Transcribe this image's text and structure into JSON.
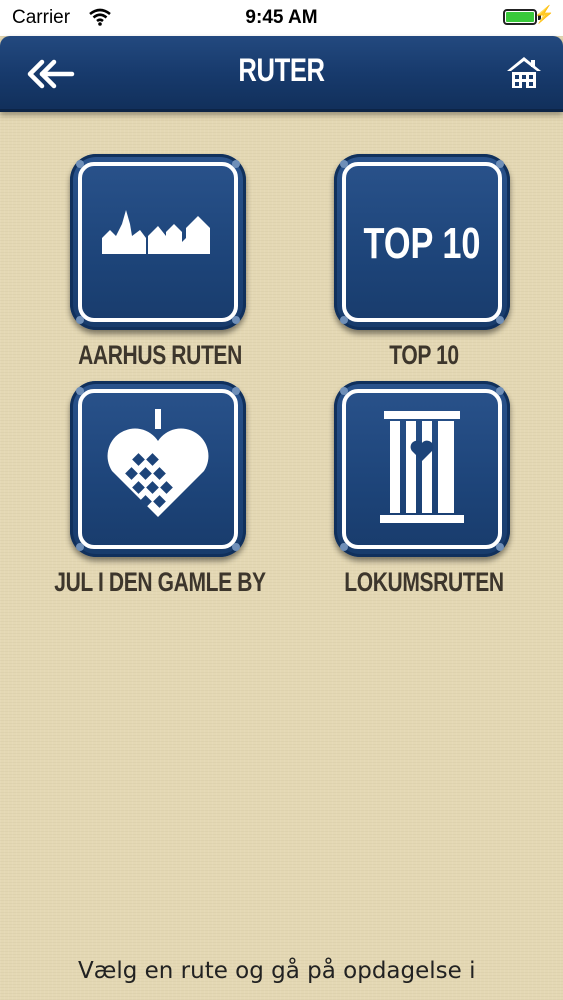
{
  "status_bar": {
    "carrier": "Carrier",
    "time": "9:45 AM",
    "battery_level": 1.0
  },
  "nav": {
    "title": "RUTER",
    "back_icon": "double-arrow-left-icon",
    "home_icon": "house-icon"
  },
  "routes": [
    {
      "label": "AARHUS RUTEN",
      "icon": "town-skyline-icon"
    },
    {
      "label": "TOP 10",
      "icon_text": "TOP 10",
      "icon": "top10-text-icon"
    },
    {
      "label": "JUL I DEN GAMLE BY",
      "icon": "woven-heart-icon"
    },
    {
      "label": "LOKUMSRUTEN",
      "icon": "outhouse-door-icon"
    }
  ],
  "intro_text": "Vælg en rute og gå på opdagelse i",
  "colors": {
    "nav_blue": "#173a6c",
    "tile_blue": "#1d4479",
    "background": "#e4d8b4",
    "label_text": "#3d362c"
  }
}
